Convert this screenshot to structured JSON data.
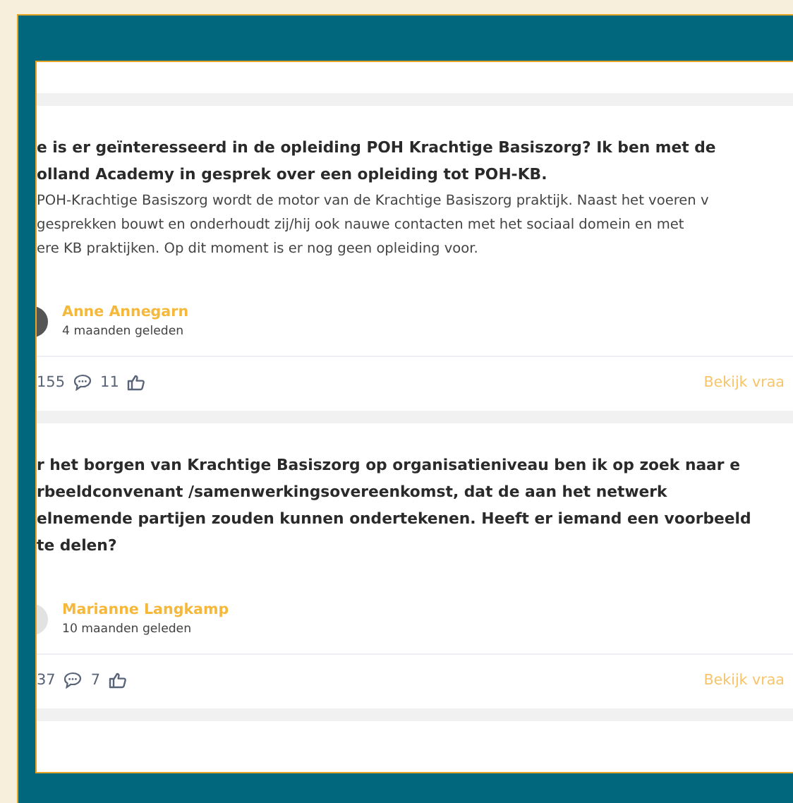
{
  "questions": [
    {
      "title_lines": [
        "e is er geïnteresseerd in de opleiding POH Krachtige Basiszorg? Ik ben met de",
        "olland Academy in gesprek over een opleiding tot POH-KB."
      ],
      "body_lines": [
        "POH-Krachtige Basiszorg wordt de motor van de Krachtige Basiszorg praktijk. Naast het voeren v",
        "gesprekken bouwt en onderhoudt zij/hij ook nauwe contacten met het sociaal domein en met",
        "ere KB praktijken. Op dit moment is er nog geen opleiding voor."
      ],
      "author": "Anne Annegarn",
      "time": "4 maanden geleden",
      "views": "155",
      "comments": "11",
      "link": "Bekijk vraa"
    },
    {
      "title_lines": [
        "r het borgen van Krachtige Basiszorg op organisatieniveau ben ik op zoek naar e",
        "rbeeldconvenant /samenwerkingsovereenkomst, dat de aan het netwerk",
        "elnemende partijen zouden kunnen ondertekenen. Heeft er iemand een voorbeeld",
        " te delen?"
      ],
      "author": "Marianne Langkamp",
      "time": "10 maanden geleden",
      "views": "37",
      "comments": "7",
      "link": "Bekijk vraa"
    }
  ]
}
